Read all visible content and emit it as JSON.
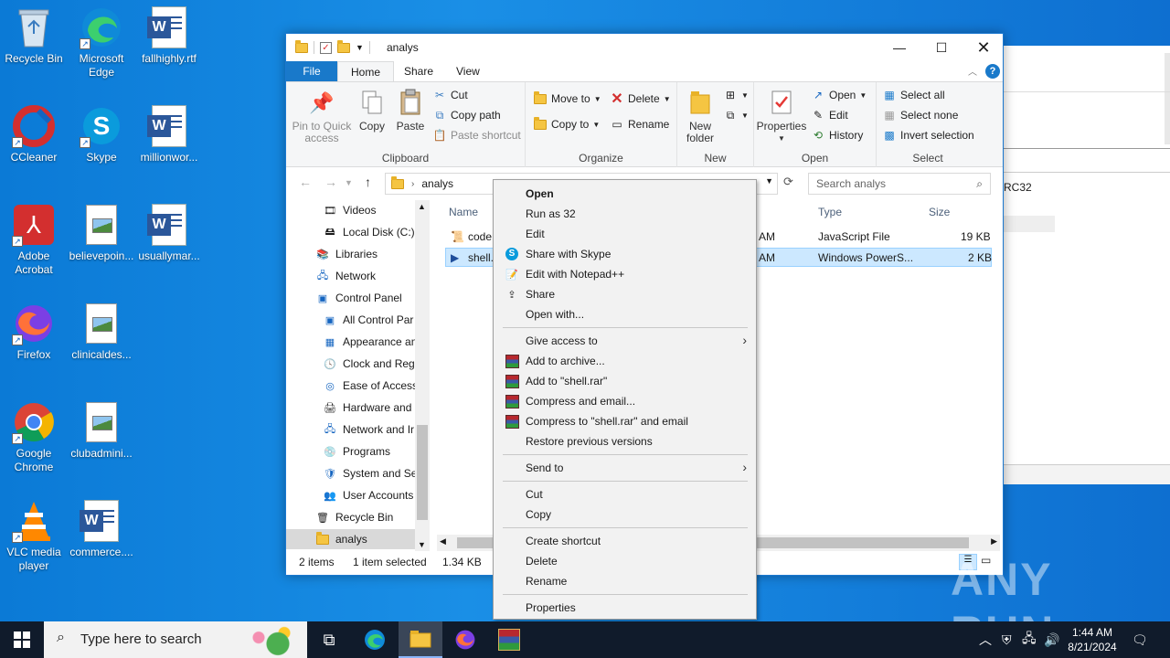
{
  "desktop": {
    "icons": [
      {
        "label": "Recycle Bin",
        "icon": "recycle-bin-icon"
      },
      {
        "label": "Microsoft Edge",
        "icon": "edge-icon"
      },
      {
        "label": "fallhighly.rtf",
        "icon": "word-doc-icon"
      },
      {
        "label": "CCleaner",
        "icon": "ccleaner-icon"
      },
      {
        "label": "Skype",
        "icon": "skype-icon"
      },
      {
        "label": "millionwor...",
        "icon": "word-doc-icon"
      },
      {
        "label": "Adobe Acrobat",
        "icon": "acrobat-icon"
      },
      {
        "label": "believepoin...",
        "icon": "image-file-icon"
      },
      {
        "label": "usuallymar...",
        "icon": "word-doc-icon"
      },
      {
        "label": "Firefox",
        "icon": "firefox-icon"
      },
      {
        "label": "clinicaldes...",
        "icon": "image-file-icon"
      },
      {
        "label": "Google Chrome",
        "icon": "chrome-icon"
      },
      {
        "label": "clubadmini...",
        "icon": "image-file-icon"
      },
      {
        "label": "VLC media player",
        "icon": "vlc-icon"
      },
      {
        "label": "commerce....",
        "icon": "word-doc-icon"
      }
    ]
  },
  "bg_window": {
    "text": "RC32"
  },
  "explorer": {
    "title": "analys",
    "tabs": {
      "file": "File",
      "home": "Home",
      "share": "Share",
      "view": "View"
    },
    "ribbon": {
      "clipboard": {
        "label": "Clipboard",
        "pin": "Pin to Quick access",
        "copy": "Copy",
        "paste": "Paste",
        "cut": "Cut",
        "copy_path": "Copy path",
        "paste_shortcut": "Paste shortcut"
      },
      "organize": {
        "label": "Organize",
        "move_to": "Move to",
        "copy_to": "Copy to",
        "delete": "Delete",
        "rename": "Rename"
      },
      "new": {
        "label": "New",
        "new_folder": "New folder"
      },
      "open": {
        "label": "Open",
        "properties": "Properties",
        "open": "Open",
        "edit": "Edit",
        "history": "History"
      },
      "select": {
        "label": "Select",
        "select_all": "Select all",
        "select_none": "Select none",
        "invert": "Invert selection"
      }
    },
    "address": {
      "path": "analys"
    },
    "search": {
      "placeholder": "Search analys"
    },
    "nav": {
      "items": [
        "Videos",
        "Local Disk (C:)",
        "Libraries",
        "Network",
        "Control Panel",
        "All Control Par",
        "Appearance an",
        "Clock and Regi",
        "Ease of Access",
        "Hardware and",
        "Network and Ir",
        "Programs",
        "System and Sec",
        "User Accounts",
        "Recycle Bin",
        "analys"
      ]
    },
    "columns": {
      "name": "Name",
      "type": "Type",
      "size": "Size"
    },
    "files": [
      {
        "name": "code.",
        "time": "AM",
        "type": "JavaScript File",
        "size": "19 KB"
      },
      {
        "name": "shell.",
        "time": "AM",
        "type": "Windows PowerS...",
        "size": "2 KB"
      }
    ],
    "status": {
      "items": "2 items",
      "selected": "1 item selected",
      "size": "1.34 KB"
    }
  },
  "context_menu": {
    "items": [
      "Open",
      "Run as 32",
      "Edit",
      "Share with Skype",
      "Edit with Notepad++",
      "Share",
      "Open with...",
      "Give access to",
      "Add to archive...",
      "Add to \"shell.rar\"",
      "Compress and email...",
      "Compress to \"shell.rar\" and email",
      "Restore previous versions",
      "Send to",
      "Cut",
      "Copy",
      "Create shortcut",
      "Delete",
      "Rename",
      "Properties"
    ]
  },
  "watermark": "ANY RUN",
  "taskbar": {
    "search_placeholder": "Type here to search",
    "time": "1:44 AM",
    "date": "8/21/2024"
  },
  "colors": {
    "accent": "#1979ca",
    "selection": "#cce8ff",
    "taskbar": "#101b2b"
  }
}
